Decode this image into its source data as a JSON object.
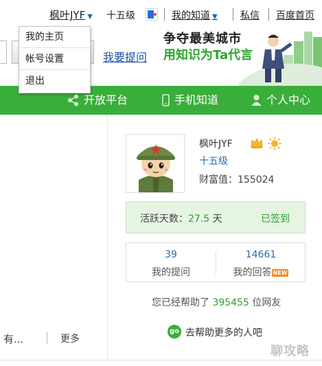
{
  "topbar": {
    "username": "枫叶JYF",
    "level": "十五级",
    "my_knowledge": "我的知道",
    "messages": "私信",
    "baidu_home": "百度首页"
  },
  "user_menu": {
    "items": [
      "我的主页",
      "帐号设置",
      "退出"
    ]
  },
  "header": {
    "ask_link": "我要提问",
    "banner_line1": "争夺最美城市",
    "banner_line2": "用知识为Ta代言"
  },
  "nav": {
    "items": [
      "开放平台",
      "手机知道",
      "个人中心"
    ]
  },
  "left_panel": {
    "truncated_text": "有...",
    "more": "更多"
  },
  "profile": {
    "name": "枫叶JYF",
    "level": "十五级",
    "wealth_label": "财富值：",
    "wealth_value": "155024"
  },
  "activity": {
    "label": "活跃天数：",
    "days": "27.5",
    "unit": "天",
    "status": "已签到"
  },
  "stats": {
    "questions_count": "39",
    "questions_label": "我的提问",
    "answers_count": "14661",
    "answers_label": "我的回答",
    "new_badge": "NEW"
  },
  "helped": {
    "prefix": "您已经帮助了",
    "count": "395455",
    "suffix": "位网友"
  },
  "help_more": {
    "icon_text": "go",
    "text": "去帮助更多的人吧"
  },
  "watermark": "聊攻略",
  "colors": {
    "brand_green": "#3aae3a",
    "link_blue": "#2a6ab3",
    "accent_green_text": "#2f9f2f"
  }
}
